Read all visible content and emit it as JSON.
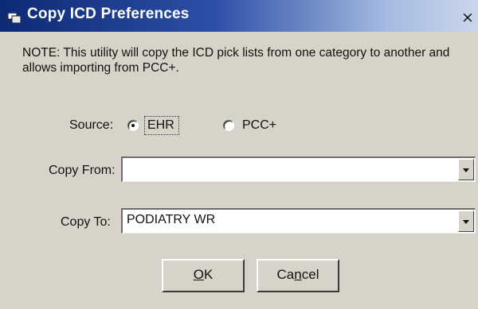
{
  "window": {
    "title": "Copy ICD Preferences",
    "close_glyph": "×"
  },
  "note": "NOTE: This utility will copy the ICD pick lists from one category to another and allows importing from PCC+.",
  "source": {
    "label": "Source:",
    "options": [
      {
        "label": "EHR",
        "selected": true
      },
      {
        "label": "PCC+",
        "selected": false
      }
    ]
  },
  "copy_from": {
    "label": "Copy From:",
    "value": ""
  },
  "copy_to": {
    "label": "Copy To:",
    "value": "PODIATRY WR"
  },
  "buttons": {
    "ok_accel": "O",
    "ok_rest": "K",
    "cancel_pre": "Ca",
    "cancel_accel": "n",
    "cancel_post": "cel"
  },
  "icons": {
    "title": "app-window-icon",
    "dropdown": "chevron-down-icon"
  }
}
